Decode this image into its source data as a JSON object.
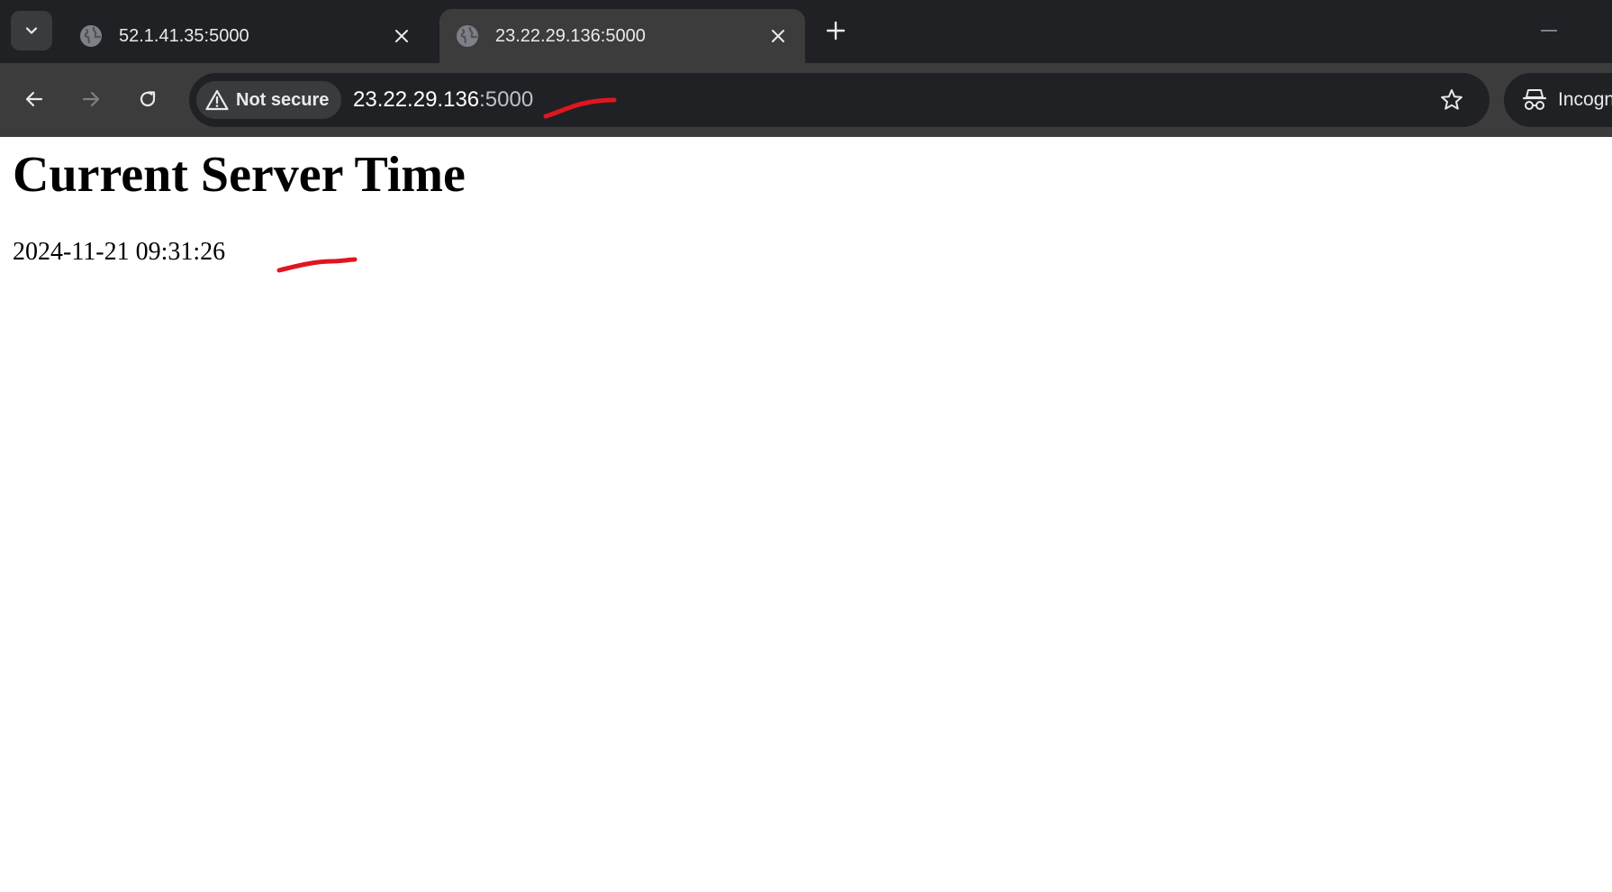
{
  "tabs": [
    {
      "title": "52.1.41.35:5000",
      "active": false
    },
    {
      "title": "23.22.29.136:5000",
      "active": true
    }
  ],
  "omnibox": {
    "security_label": "Not secure",
    "url_host": "23.22.29.136",
    "url_port": ":5000"
  },
  "profile": {
    "label": "Incognito"
  },
  "page": {
    "heading": "Current Server Time",
    "time": "2024-11-21 09:31:26"
  },
  "colors": {
    "tab_strip": "#202124",
    "toolbar": "#3c3c3c",
    "annotation": "#e0161f"
  }
}
